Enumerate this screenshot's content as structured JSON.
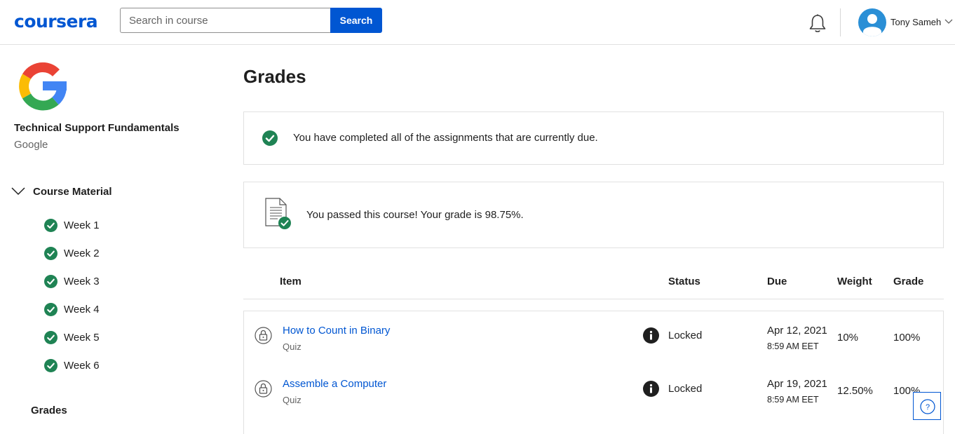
{
  "header": {
    "logo_text": "coursera",
    "search": {
      "placeholder": "Search in course",
      "value": ""
    },
    "search_button": "Search",
    "user_name": "Tony Sameh"
  },
  "sidebar": {
    "course_title": "Technical Support Fundamentals",
    "course_partner": "Google",
    "section_title": "Course Material",
    "weeks": [
      {
        "label": "Week 1",
        "completed": true
      },
      {
        "label": "Week 2",
        "completed": true
      },
      {
        "label": "Week 3",
        "completed": true
      },
      {
        "label": "Week 4",
        "completed": true
      },
      {
        "label": "Week 5",
        "completed": true
      },
      {
        "label": "Week 6",
        "completed": true
      }
    ],
    "grades_label": "Grades"
  },
  "main": {
    "title": "Grades",
    "completion_message": "You have completed all of the assignments that are currently due.",
    "pass_message": "You passed this course! Your grade is 98.75%.",
    "table": {
      "headers": {
        "item": "Item",
        "status": "Status",
        "due": "Due",
        "weight": "Weight",
        "grade": "Grade"
      },
      "rows": [
        {
          "name": "How to Count in Binary",
          "type": "Quiz",
          "status": "Locked",
          "due_date": "Apr 12, 2021",
          "due_time": "8:59 AM EET",
          "weight": "10%",
          "grade": "100%"
        },
        {
          "name": "Assemble a Computer",
          "type": "Quiz",
          "status": "Locked",
          "due_date": "Apr 19, 2021",
          "due_time": "8:59 AM EET",
          "weight": "12.50%",
          "grade": "100%"
        }
      ]
    }
  },
  "colors": {
    "brand": "#0056d2",
    "success": "#1f8354",
    "text": "#1f1f1f",
    "muted": "#636363",
    "border": "#e1e1e1"
  },
  "icons": {
    "bell": "bell-icon",
    "avatar": "user-avatar-icon",
    "check": "check-circle-icon",
    "document": "document-check-icon",
    "lock": "lock-icon",
    "info": "info-icon",
    "help": "help-icon"
  }
}
